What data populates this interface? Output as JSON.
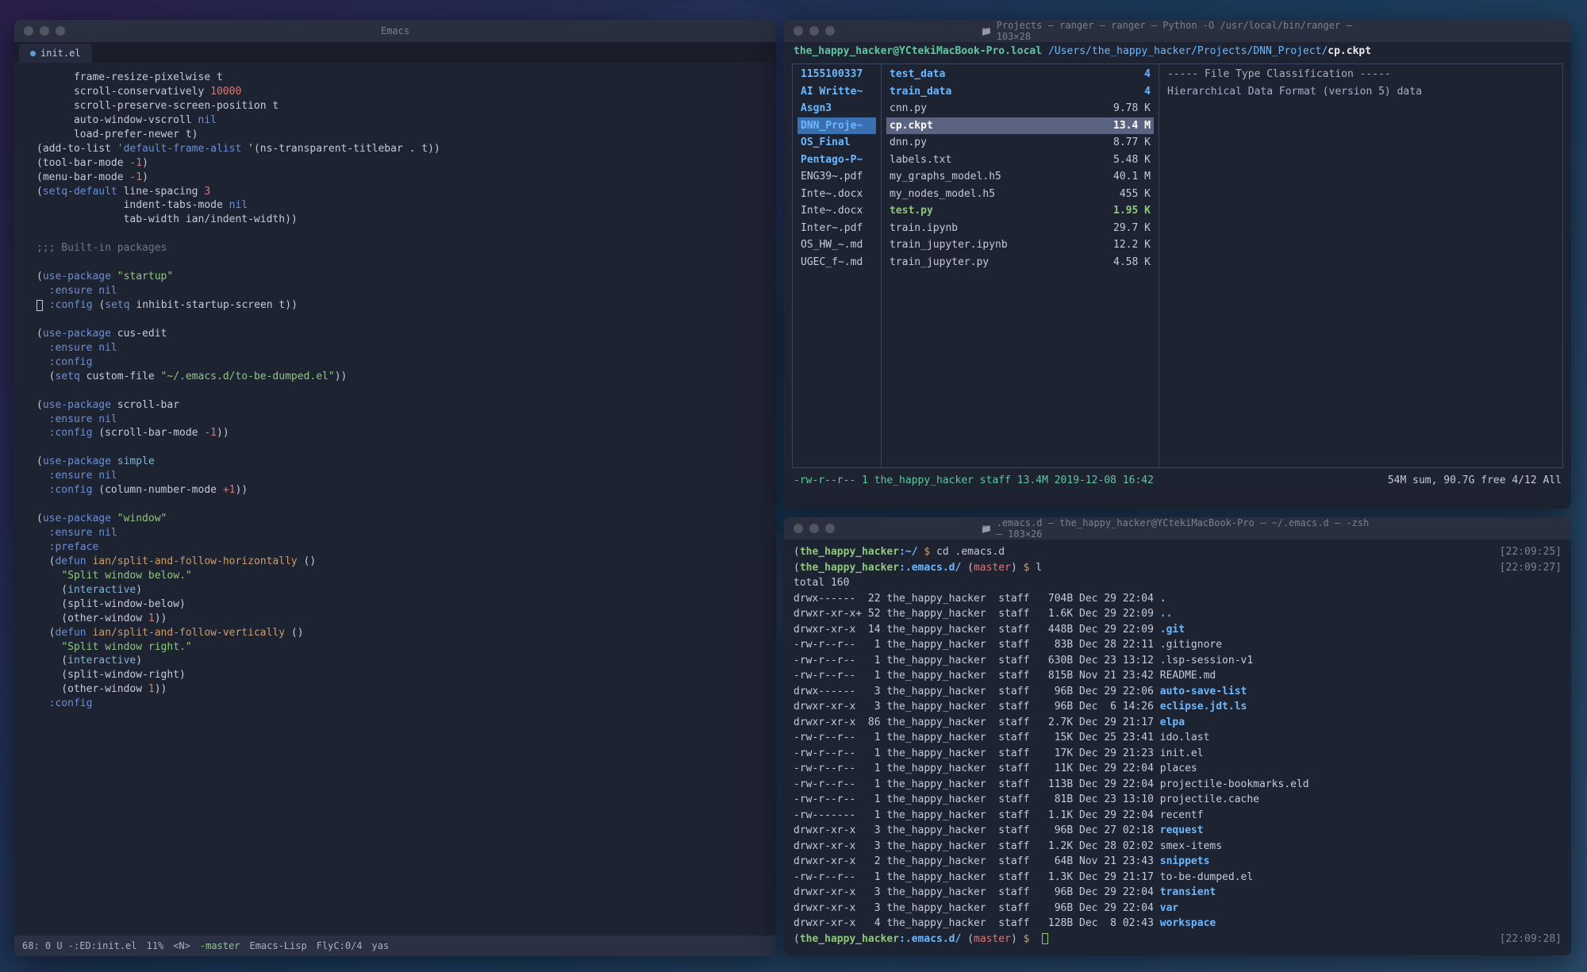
{
  "emacs": {
    "title": "Emacs",
    "tab": "init.el",
    "modeline": {
      "left": "68: 0 U -:ED:init.el",
      "percent": "11%",
      "encoding": "<N>",
      "branch": "master",
      "mode": "Emacs-Lisp",
      "flyc": "FlyC:0/4",
      "yas": "yas"
    },
    "code_tokens": [
      [
        [
          "",
          "      frame-resize-pixelwise t"
        ]
      ],
      [
        [
          "",
          "      scroll-conservatively "
        ],
        [
          "num",
          "10000"
        ]
      ],
      [
        [
          "",
          "      scroll-preserve-screen-position t"
        ]
      ],
      [
        [
          "",
          "      auto-window-vscroll "
        ],
        [
          "kw",
          "nil"
        ]
      ],
      [
        [
          "",
          "      load-prefer-newer t)"
        ]
      ],
      [
        [
          "",
          "(add-to-list "
        ],
        [
          "kw",
          "'default-frame-alist"
        ],
        [
          "",
          " '(ns-transparent-titlebar . t))"
        ]
      ],
      [
        [
          "",
          "(tool-bar-mode "
        ],
        [
          "num",
          "-1"
        ],
        [
          "",
          ")"
        ]
      ],
      [
        [
          "",
          "(menu-bar-mode "
        ],
        [
          "num",
          "-1"
        ],
        [
          "",
          ")"
        ]
      ],
      [
        [
          "",
          "("
        ],
        [
          "kw",
          "setq-default"
        ],
        [
          "",
          " line-spacing "
        ],
        [
          "num",
          "3"
        ]
      ],
      [
        [
          "",
          "              indent-tabs-mode "
        ],
        [
          "kw",
          "nil"
        ]
      ],
      [
        [
          "",
          "              tab-width ian/indent-width))"
        ]
      ],
      [
        [
          "",
          ""
        ]
      ],
      [
        [
          "comment",
          ";;; Built-in packages"
        ]
      ],
      [
        [
          "",
          ""
        ]
      ],
      [
        [
          "",
          "("
        ],
        [
          "kw",
          "use-package"
        ],
        [
          "",
          " "
        ],
        [
          "str",
          "\"startup\""
        ]
      ],
      [
        [
          "",
          "  "
        ],
        [
          "kw",
          ":ensure"
        ],
        [
          "",
          " "
        ],
        [
          "kw",
          "nil"
        ]
      ],
      [
        [
          "cursor",
          ""
        ],
        [
          "",
          " "
        ],
        [
          "kw",
          ":config"
        ],
        [
          "",
          " ("
        ],
        [
          "kw",
          "setq"
        ],
        [
          "",
          " inhibit-startup-screen t))"
        ]
      ],
      [
        [
          "",
          ""
        ]
      ],
      [
        [
          "",
          "("
        ],
        [
          "kw",
          "use-package"
        ],
        [
          "",
          " cus-edit"
        ]
      ],
      [
        [
          "",
          "  "
        ],
        [
          "kw",
          ":ensure"
        ],
        [
          "",
          " "
        ],
        [
          "kw",
          "nil"
        ]
      ],
      [
        [
          "",
          "  "
        ],
        [
          "kw",
          ":config"
        ]
      ],
      [
        [
          "",
          "  ("
        ],
        [
          "kw",
          "setq"
        ],
        [
          "",
          " custom-file "
        ],
        [
          "str",
          "\"~/.emacs.d/to-be-dumped.el\""
        ],
        [
          "",
          ")) "
        ]
      ],
      [
        [
          "",
          ""
        ]
      ],
      [
        [
          "",
          "("
        ],
        [
          "kw",
          "use-package"
        ],
        [
          "",
          " scroll-bar"
        ]
      ],
      [
        [
          "",
          "  "
        ],
        [
          "kw",
          ":ensure"
        ],
        [
          "",
          " "
        ],
        [
          "kw",
          "nil"
        ]
      ],
      [
        [
          "",
          "  "
        ],
        [
          "kw",
          ":config"
        ],
        [
          "",
          " (scroll-bar-mode "
        ],
        [
          "num",
          "-1"
        ],
        [
          "",
          "))"
        ]
      ],
      [
        [
          "",
          ""
        ]
      ],
      [
        [
          "",
          "("
        ],
        [
          "kw",
          "use-package"
        ],
        [
          "",
          " "
        ],
        [
          "pkg",
          "simple"
        ]
      ],
      [
        [
          "",
          "  "
        ],
        [
          "kw",
          ":ensure"
        ],
        [
          "",
          " "
        ],
        [
          "kw",
          "nil"
        ]
      ],
      [
        [
          "",
          "  "
        ],
        [
          "kw",
          ":config"
        ],
        [
          "",
          " (column-number-mode "
        ],
        [
          "num",
          "+1"
        ],
        [
          "",
          "))"
        ]
      ],
      [
        [
          "",
          ""
        ]
      ],
      [
        [
          "",
          "("
        ],
        [
          "kw",
          "use-package"
        ],
        [
          "",
          " "
        ],
        [
          "str",
          "\"window\""
        ]
      ],
      [
        [
          "",
          "  "
        ],
        [
          "kw",
          ":ensure"
        ],
        [
          "",
          " "
        ],
        [
          "kw",
          "nil"
        ]
      ],
      [
        [
          "",
          "  "
        ],
        [
          "kw",
          ":preface"
        ]
      ],
      [
        [
          "",
          "  ("
        ],
        [
          "kw",
          "defun"
        ],
        [
          "",
          " "
        ],
        [
          "fn",
          "ian/split-and-follow-horizontally"
        ],
        [
          "",
          " ()"
        ]
      ],
      [
        [
          "",
          "    "
        ],
        [
          "str",
          "\"Split window below.\""
        ]
      ],
      [
        [
          "",
          "    ("
        ],
        [
          "pkg",
          "interactive"
        ],
        [
          "",
          ")"
        ]
      ],
      [
        [
          "",
          "    (split-window-below)"
        ]
      ],
      [
        [
          "",
          "    (other-window "
        ],
        [
          "num",
          "1"
        ],
        [
          "",
          "))"
        ]
      ],
      [
        [
          "",
          "  ("
        ],
        [
          "kw",
          "defun"
        ],
        [
          "",
          " "
        ],
        [
          "fn",
          "ian/split-and-follow-vertically"
        ],
        [
          "",
          " ()"
        ]
      ],
      [
        [
          "",
          "    "
        ],
        [
          "str",
          "\"Split window right.\""
        ]
      ],
      [
        [
          "",
          "    ("
        ],
        [
          "pkg",
          "interactive"
        ],
        [
          "",
          ")"
        ]
      ],
      [
        [
          "",
          "    (split-window-right)"
        ]
      ],
      [
        [
          "",
          "    (other-window "
        ],
        [
          "num",
          "1"
        ],
        [
          "",
          "))"
        ]
      ],
      [
        [
          "",
          "  "
        ],
        [
          "kw",
          ":config"
        ]
      ]
    ]
  },
  "ranger": {
    "title": "Projects — ranger — ranger — Python -O /usr/local/bin/ranger — 103×28",
    "user": "the_happy_hacker@YCtekiMacBook-Pro.local",
    "path": "/Users/the_happy_hacker/Projects/DNN_Project/",
    "file": "cp.ckpt",
    "left_col": [
      {
        "name": "1155100337",
        "dir": true
      },
      {
        "name": "AI Writte~",
        "dir": true
      },
      {
        "name": "Asgn3",
        "dir": true
      },
      {
        "name": "DNN_Proje~",
        "dir": true,
        "selected": true
      },
      {
        "name": "OS_Final",
        "dir": true
      },
      {
        "name": "Pentago-P~",
        "dir": true
      },
      {
        "name": "ENG39~.pdf"
      },
      {
        "name": "Inte~.docx"
      },
      {
        "name": "Inte~.docx"
      },
      {
        "name": "Inter~.pdf"
      },
      {
        "name": "OS_HW_~.md"
      },
      {
        "name": "UGEC_f~.md"
      }
    ],
    "mid_col": [
      {
        "name": "test_data",
        "size": "4",
        "dir": true
      },
      {
        "name": "train_data",
        "size": "4",
        "dir": true
      },
      {
        "name": "cnn.py",
        "size": "9.78 K"
      },
      {
        "name": "cp.ckpt",
        "size": "13.4 M",
        "selected": true
      },
      {
        "name": "dnn.py",
        "size": "8.77 K"
      },
      {
        "name": "labels.txt",
        "size": "5.48 K"
      },
      {
        "name": "my_graphs_model.h5",
        "size": "40.1 M"
      },
      {
        "name": "my_nodes_model.h5",
        "size": "455 K"
      },
      {
        "name": "test.py",
        "size": "1.95 K",
        "exec": true
      },
      {
        "name": "train.ipynb",
        "size": "29.7 K"
      },
      {
        "name": "train_jupyter.ipynb",
        "size": "12.2 K"
      },
      {
        "name": "train_jupyter.py",
        "size": "4.58 K"
      }
    ],
    "right_col": [
      "----- File Type Classification -----",
      "Hierarchical Data Format (version 5) data"
    ],
    "status_left": "-rw-r--r-- 1 the_happy_hacker staff 13.4M 2019-12-08 16:42",
    "status_right": "54M sum, 90.7G free  4/12  All"
  },
  "zsh": {
    "title": ".emacs.d — the_happy_hacker@YCtekiMacBook-Pro — ~/.emacs.d — -zsh — 103×26",
    "lines": [
      {
        "prompt": {
          "user": "the_happy_hacker",
          "path": ":~/",
          "cmd": "cd .emacs.d"
        },
        "ts": "[22:09:25]"
      },
      {
        "prompt": {
          "user": "the_happy_hacker",
          "path": ":.emacs.d/",
          "branch": "master",
          "cmd": "l"
        },
        "ts": "[22:09:27]"
      },
      {
        "raw": "total 160"
      },
      {
        "perm": "drwx------",
        "n": "22",
        "own": "the_happy_hacker",
        "grp": "staff",
        "size": "704B",
        "date": "Dec 29 22:04",
        "name": ".",
        "dir": true
      },
      {
        "perm": "drwxr-xr-x+",
        "n": "52",
        "own": "the_happy_hacker",
        "grp": "staff",
        "size": "1.6K",
        "date": "Dec 29 22:09",
        "name": "..",
        "dir": true
      },
      {
        "perm": "drwxr-xr-x",
        "n": "14",
        "own": "the_happy_hacker",
        "grp": "staff",
        "size": "448B",
        "date": "Dec 29 22:09",
        "name": ".git",
        "dir": true
      },
      {
        "perm": "-rw-r--r--",
        "n": "1",
        "own": "the_happy_hacker",
        "grp": "staff",
        "size": "83B",
        "date": "Dec 28 22:11",
        "name": ".gitignore"
      },
      {
        "perm": "-rw-r--r--",
        "n": "1",
        "own": "the_happy_hacker",
        "grp": "staff",
        "size": "630B",
        "date": "Dec 23 13:12",
        "name": ".lsp-session-v1"
      },
      {
        "perm": "-rw-r--r--",
        "n": "1",
        "own": "the_happy_hacker",
        "grp": "staff",
        "size": "815B",
        "date": "Nov 21 23:42",
        "name": "README.md"
      },
      {
        "perm": "drwx------",
        "n": "3",
        "own": "the_happy_hacker",
        "grp": "staff",
        "size": "96B",
        "date": "Dec 29 22:06",
        "name": "auto-save-list",
        "dir": true
      },
      {
        "perm": "drwxr-xr-x",
        "n": "3",
        "own": "the_happy_hacker",
        "grp": "staff",
        "size": "96B",
        "date": "Dec  6 14:26",
        "name": "eclipse.jdt.ls",
        "dir": true
      },
      {
        "perm": "drwxr-xr-x",
        "n": "86",
        "own": "the_happy_hacker",
        "grp": "staff",
        "size": "2.7K",
        "date": "Dec 29 21:17",
        "name": "elpa",
        "dir": true
      },
      {
        "perm": "-rw-r--r--",
        "n": "1",
        "own": "the_happy_hacker",
        "grp": "staff",
        "size": "15K",
        "date": "Dec 25 23:41",
        "name": "ido.last"
      },
      {
        "perm": "-rw-r--r--",
        "n": "1",
        "own": "the_happy_hacker",
        "grp": "staff",
        "size": "17K",
        "date": "Dec 29 21:23",
        "name": "init.el"
      },
      {
        "perm": "-rw-r--r--",
        "n": "1",
        "own": "the_happy_hacker",
        "grp": "staff",
        "size": "11K",
        "date": "Dec 29 22:04",
        "name": "places"
      },
      {
        "perm": "-rw-r--r--",
        "n": "1",
        "own": "the_happy_hacker",
        "grp": "staff",
        "size": "113B",
        "date": "Dec 29 22:04",
        "name": "projectile-bookmarks.eld"
      },
      {
        "perm": "-rw-r--r--",
        "n": "1",
        "own": "the_happy_hacker",
        "grp": "staff",
        "size": "81B",
        "date": "Dec 23 13:10",
        "name": "projectile.cache"
      },
      {
        "perm": "-rw-------",
        "n": "1",
        "own": "the_happy_hacker",
        "grp": "staff",
        "size": "1.1K",
        "date": "Dec 29 22:04",
        "name": "recentf"
      },
      {
        "perm": "drwxr-xr-x",
        "n": "3",
        "own": "the_happy_hacker",
        "grp": "staff",
        "size": "96B",
        "date": "Dec 27 02:18",
        "name": "request",
        "dir": true
      },
      {
        "perm": "drwxr-xr-x",
        "n": "3",
        "own": "the_happy_hacker",
        "grp": "staff",
        "size": "1.2K",
        "date": "Dec 28 02:02",
        "name": "smex-items"
      },
      {
        "perm": "drwxr-xr-x",
        "n": "2",
        "own": "the_happy_hacker",
        "grp": "staff",
        "size": "64B",
        "date": "Nov 21 23:43",
        "name": "snippets",
        "dir": true
      },
      {
        "perm": "-rw-r--r--",
        "n": "1",
        "own": "the_happy_hacker",
        "grp": "staff",
        "size": "1.3K",
        "date": "Dec 29 21:17",
        "name": "to-be-dumped.el"
      },
      {
        "perm": "drwxr-xr-x",
        "n": "3",
        "own": "the_happy_hacker",
        "grp": "staff",
        "size": "96B",
        "date": "Dec 29 22:04",
        "name": "transient",
        "dir": true
      },
      {
        "perm": "drwxr-xr-x",
        "n": "3",
        "own": "the_happy_hacker",
        "grp": "staff",
        "size": "96B",
        "date": "Dec 29 22:04",
        "name": "var",
        "dir": true
      },
      {
        "perm": "drwxr-xr-x",
        "n": "4",
        "own": "the_happy_hacker",
        "grp": "staff",
        "size": "128B",
        "date": "Dec  8 02:43",
        "name": "workspace",
        "dir": true
      },
      {
        "prompt": {
          "user": "the_happy_hacker",
          "path": ":.emacs.d/",
          "branch": "master",
          "cmd": ""
        },
        "cursor": true,
        "ts": "[22:09:28]"
      }
    ]
  }
}
